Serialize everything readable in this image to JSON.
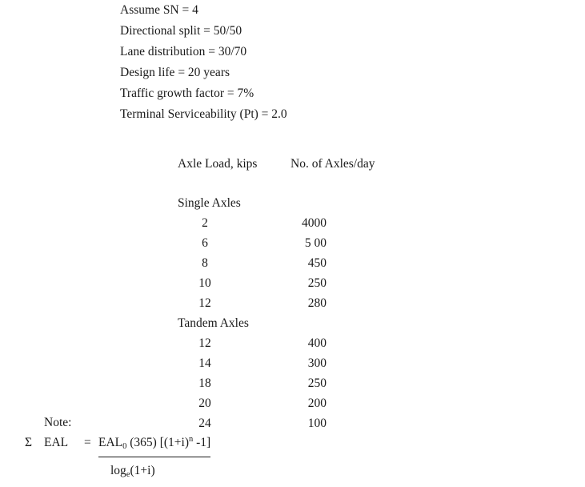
{
  "assumptions": [
    "Assume SN = 4",
    "Directional split = 50/50",
    "Lane distribution = 30/70",
    "Design life = 20 years",
    "Traffic growth factor = 7%",
    "Terminal Serviceability (Pt) = 2.0"
  ],
  "table": {
    "headers": {
      "load": "Axle Load, kips",
      "count": "No. of Axles/day"
    },
    "groups": [
      {
        "label": "Single Axles",
        "rows": [
          {
            "load": "2",
            "count": "4000"
          },
          {
            "load": "6",
            "count": "5 00"
          },
          {
            "load": "8",
            "count": "450"
          },
          {
            "load": "10",
            "count": "250"
          },
          {
            "load": "12",
            "count": "280"
          }
        ]
      },
      {
        "label": "Tandem Axles",
        "rows": [
          {
            "load": "12",
            "count": "400"
          },
          {
            "load": "14",
            "count": "300"
          },
          {
            "load": "18",
            "count": "250"
          },
          {
            "load": "20",
            "count": "200"
          },
          {
            "load": "24",
            "count": "100"
          }
        ]
      }
    ]
  },
  "note": {
    "label": "Note:",
    "formula": {
      "sigma": "Σ",
      "lhs": "EAL",
      "equals": "=",
      "numerator_parts": {
        "base": "EAL",
        "subscript": "0",
        "middle": " (365) [(1+i)",
        "superscript": "n",
        "tail": " -1]"
      },
      "denominator_parts": {
        "base": "log",
        "subscript": "e",
        "tail": "(1+i)"
      }
    }
  }
}
